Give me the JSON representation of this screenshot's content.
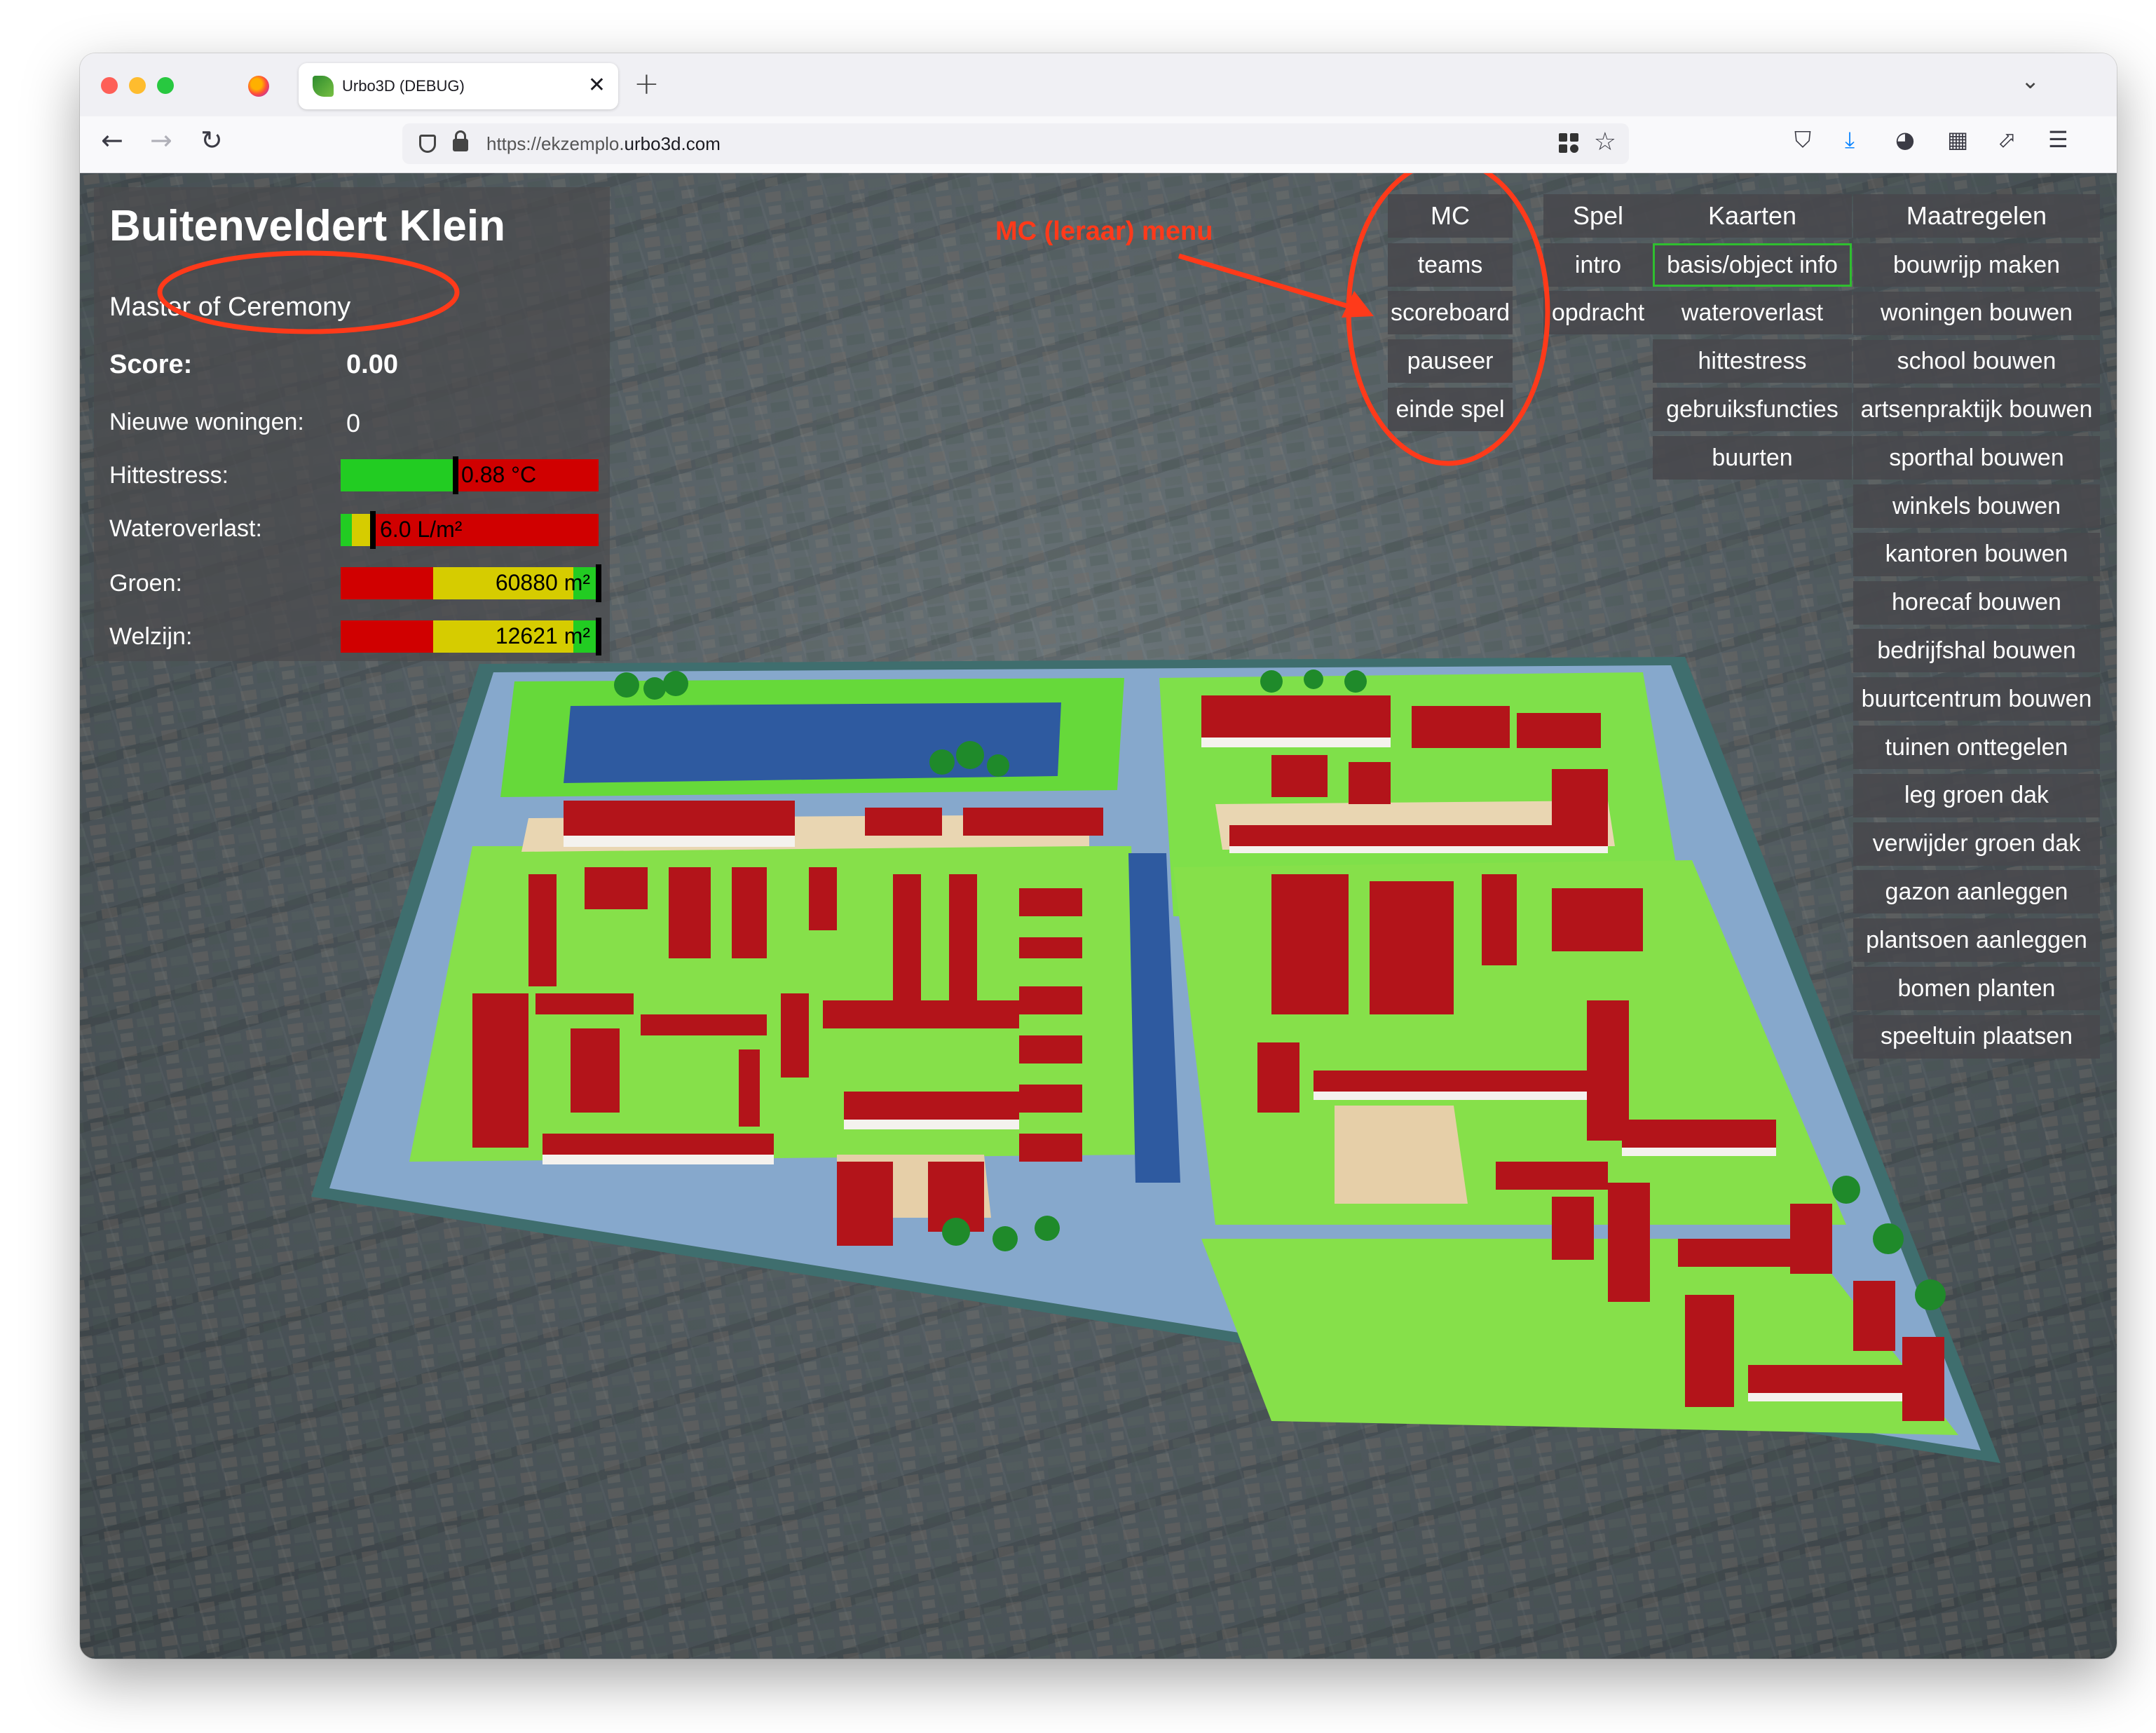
{
  "browser": {
    "tab_title": "Urbo3D (DEBUG)",
    "url_prefix": "https://ekzemplo.",
    "url_host": "urbo3d.com",
    "new_tab_symbol": "+",
    "close_symbol": "✕",
    "tab_list_symbol": "⌄"
  },
  "stats": {
    "title": "Buitenveldert Klein",
    "role": "Master of Ceremony",
    "score_label": "Score:",
    "score_value": "0.00",
    "new_homes_label": "Nieuwe woningen:",
    "new_homes_value": "0",
    "heat_label": "Hittestress:",
    "heat_value": "0.88 °C",
    "water_label": "Wateroverlast:",
    "water_value": "6.0 L/m²",
    "green_label": "Groen:",
    "green_value": "60880 m²",
    "wellbeing_label": "Welzijn:",
    "wellbeing_value": "12621 m²"
  },
  "menu": {
    "mc": {
      "header": "MC",
      "items": [
        "teams",
        "scoreboard",
        "pauseer",
        "einde spel"
      ]
    },
    "spel": {
      "header": "Spel",
      "items": [
        "intro",
        "opdracht"
      ]
    },
    "kaarten": {
      "header": "Kaarten",
      "items": [
        "basis/object info",
        "wateroverlast",
        "hittestress",
        "gebruiksfuncties",
        "buurten"
      ],
      "active": "basis/object info"
    },
    "maatregelen": {
      "header": "Maatregelen",
      "items": [
        "bouwrijp maken",
        "woningen bouwen",
        "school bouwen",
        "artsenpraktijk bouwen",
        "sporthal bouwen",
        "winkels bouwen",
        "kantoren bouwen",
        "horecaf bouwen",
        "bedrijfshal bouwen",
        "buurtcentrum bouwen",
        "tuinen onttegelen",
        "leg groen dak",
        "verwijder groen dak",
        "gazon aanleggen",
        "plantsoen aanleggen",
        "bomen planten",
        "speeltuin plaatsen"
      ]
    }
  },
  "annotation": {
    "label": "MC (leraar) menu"
  },
  "colors": {
    "accent_red": "#ff3a1a",
    "active_border": "#2fbf2f",
    "bar_red": "#d00000",
    "bar_green": "#22cc22",
    "bar_yellow": "#d6cc00"
  }
}
